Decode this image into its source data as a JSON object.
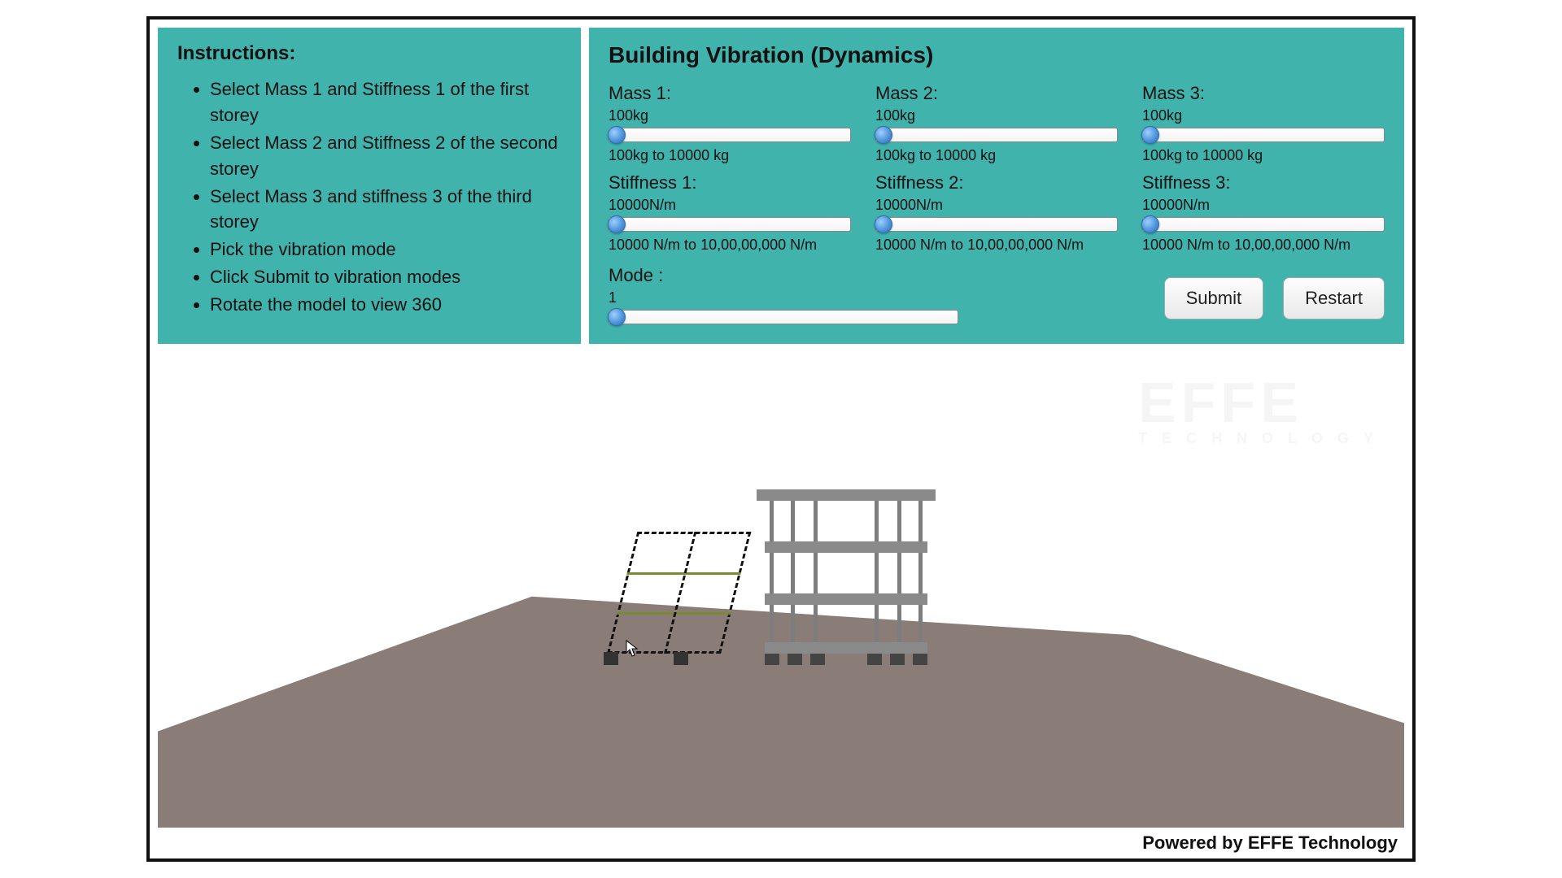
{
  "instructions": {
    "heading": "Instructions:",
    "items": [
      "Select Mass 1 and Stiffness 1 of the first storey",
      "Select Mass 2 and Stiffness 2 of the second storey",
      "Select Mass 3 and stiffness 3 of the third storey",
      "Pick the vibration mode",
      "Click Submit to vibration modes",
      "Rotate the model to view 360"
    ]
  },
  "controls": {
    "title": "Building Vibration (Dynamics)",
    "mass1": {
      "label": "Mass 1:",
      "value": "100kg",
      "range": "100kg to 10000 kg"
    },
    "mass2": {
      "label": "Mass 2:",
      "value": "100kg",
      "range": "100kg to 10000 kg"
    },
    "mass3": {
      "label": "Mass 3:",
      "value": "100kg",
      "range": "100kg to 10000 kg"
    },
    "stiff1": {
      "label": "Stiffness 1:",
      "value": "10000N/m",
      "range": "10000 N/m to 10,00,00,000 N/m"
    },
    "stiff2": {
      "label": "Stiffness 2:",
      "value": "10000N/m",
      "range": "10000 N/m to 10,00,00,000 N/m"
    },
    "stiff3": {
      "label": "Stiffness 3:",
      "value": "10000N/m",
      "range": "10000 N/m to 10,00,00,000 N/m"
    },
    "mode": {
      "label": "Mode :",
      "value": "1"
    },
    "buttons": {
      "submit": "Submit",
      "restart": "Restart"
    }
  },
  "footer": "Powered by EFFE Technology",
  "watermark": {
    "line1": "EFFE",
    "line2": "TECHNOLOGY"
  }
}
